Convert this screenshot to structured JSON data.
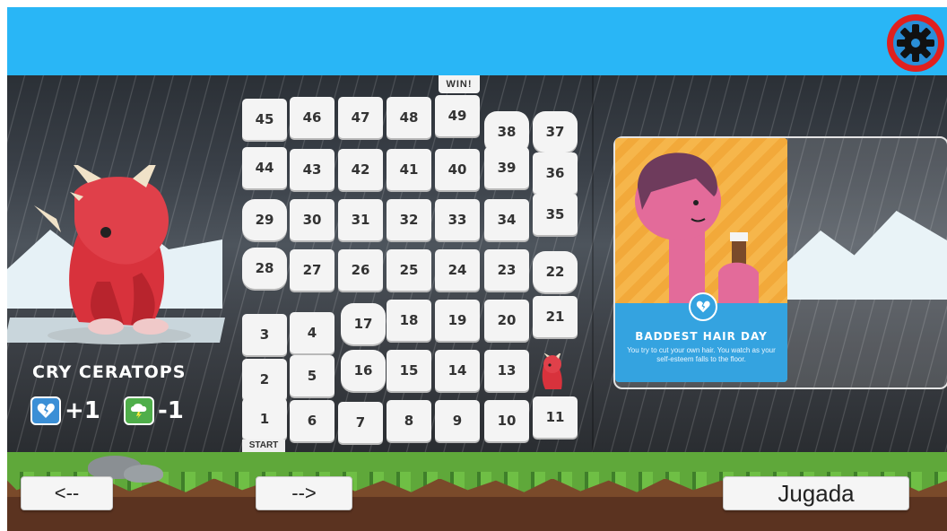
{
  "colors": {
    "topbar": "#29b6f6",
    "settings_ring": "#e0201e",
    "card_footer": "#34a3e0",
    "dino_red": "#d8323c",
    "grass": "#5fa83a"
  },
  "header": {
    "settings_icon": "gear-icon"
  },
  "board": {
    "win_label": "WIN!",
    "start_label": "START",
    "cells": [
      "45",
      "46",
      "47",
      "48",
      "49",
      "38",
      "37",
      "44",
      "43",
      "42",
      "41",
      "40",
      "39",
      "36",
      "29",
      "30",
      "31",
      "32",
      "33",
      "34",
      "35",
      "28",
      "27",
      "26",
      "25",
      "24",
      "23",
      "22",
      "3",
      "4",
      "17",
      "18",
      "19",
      "20",
      "21",
      "2",
      "5",
      "16",
      "15",
      "14",
      "13",
      "1",
      "6",
      "7",
      "8",
      "9",
      "10",
      "11"
    ]
  },
  "character": {
    "name": "CRY CERATOPS",
    "stats": [
      {
        "icon": "broken-heart-icon",
        "value": "+1"
      },
      {
        "icon": "storm-cloud-icon",
        "value": "-1"
      }
    ]
  },
  "card": {
    "title": "BADDEST HAIR DAY",
    "text": "You try to cut your own hair. You watch as your self-esteem falls to the floor.",
    "badge_icon": "broken-heart-icon"
  },
  "controls": {
    "prev_label": "<--",
    "next_label": "-->",
    "play_label": "Jugada"
  }
}
